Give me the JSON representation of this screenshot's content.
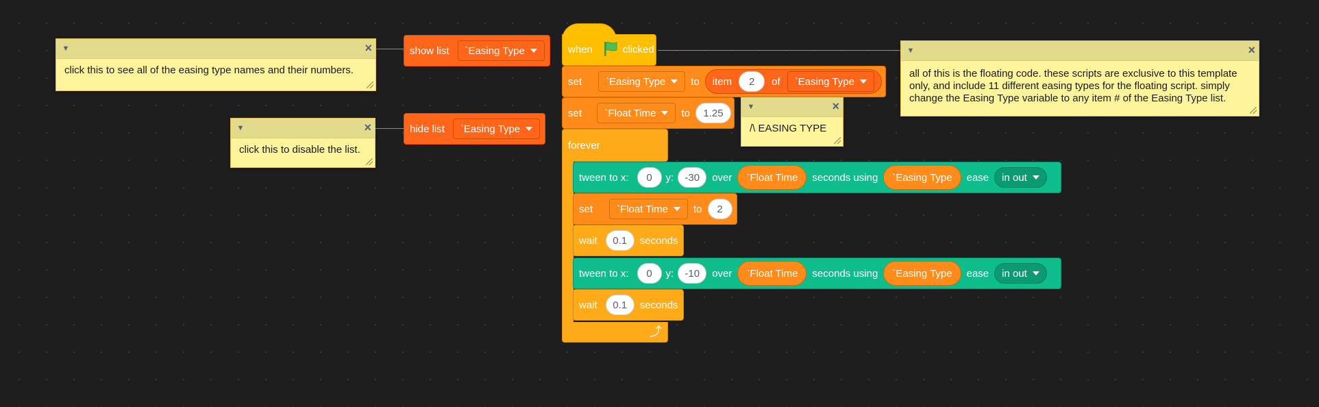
{
  "comments": {
    "show_list_note": "click this to see all of the easing type names and their numbers.",
    "hide_list_note": "click this to disable the list.",
    "easing_note": "/\\ EASING TYPE",
    "floating_note": "all of this is the floating code. these scripts are exclusive to this template only, and include 11 different easing types for the floating script. simply change the Easing Type variable to any item # of the Easing Type list."
  },
  "show_list_block": {
    "label": "show list",
    "list": "`Easing Type"
  },
  "hide_list_block": {
    "label": "hide list",
    "list": "`Easing Type"
  },
  "hat_block": {
    "when": "when",
    "clicked": "clicked"
  },
  "set_easing": {
    "set": "set",
    "variable": "`Easing Type",
    "to": "to",
    "item": "item",
    "index": "2",
    "of": "of",
    "list": "`Easing Type"
  },
  "set_float_time": {
    "set": "set",
    "variable": "`Float Time",
    "to": "to",
    "value": "1.25"
  },
  "forever": {
    "label": "forever"
  },
  "tween_1": {
    "label": "tween to x:",
    "x": "0",
    "y_label": "y:",
    "y": "-30",
    "over": "over",
    "duration_var": "`Float Time",
    "seconds_using": "seconds using",
    "easing_var": "`Easing Type",
    "ease": "ease",
    "mode": "in out"
  },
  "set_float_inner": {
    "set": "set",
    "variable": "`Float Time",
    "to": "to",
    "value": "2"
  },
  "wait_1": {
    "wait": "wait",
    "value": "0.1",
    "seconds": "seconds"
  },
  "tween_2": {
    "label": "tween to x:",
    "x": "0",
    "y_label": "y:",
    "y": "-10",
    "over": "over",
    "duration_var": "`Float Time",
    "seconds_using": "seconds using",
    "easing_var": "`Easing Type",
    "ease": "ease",
    "mode": "in out"
  },
  "wait_2": {
    "wait": "wait",
    "value": "0.1",
    "seconds": "seconds"
  },
  "icons": [
    "dropdown-arrow-icon",
    "close-icon",
    "flag-icon",
    "loop-arrow-icon",
    "resize-handle-icon"
  ],
  "colors": {
    "events": "#ffbf00",
    "control": "#ffab19",
    "variables": "#ff8c1a",
    "lists": "#ff661a",
    "tween": "#0fbd8c",
    "comment": "#fef49c"
  }
}
